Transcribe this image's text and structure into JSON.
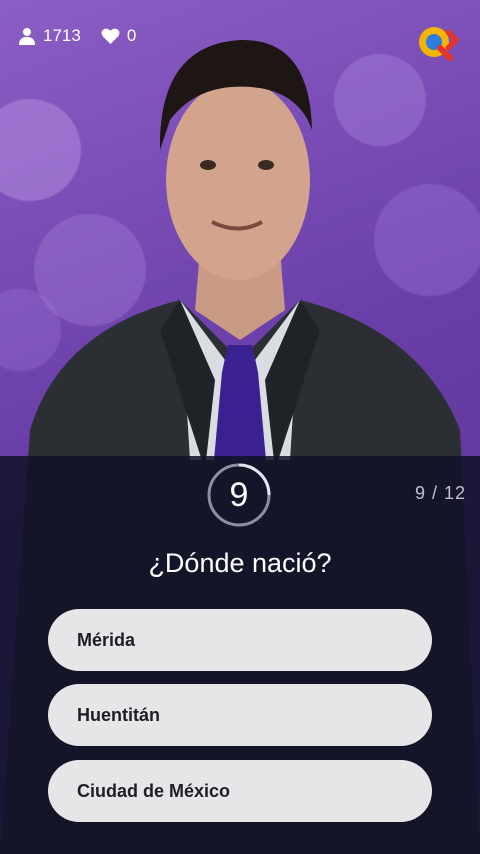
{
  "hud": {
    "players_count": "1713",
    "lives_count": "0",
    "players_icon": "person-icon",
    "lives_icon": "heart-icon"
  },
  "logo": {
    "icon": "app-logo-q",
    "colors": [
      "#f5b400",
      "#e8332a",
      "#2a7de1"
    ]
  },
  "quiz": {
    "timer_value": "9",
    "progress": "9 / 12",
    "question": "¿Dónde nació?",
    "answers": [
      "Mérida",
      "Huentitán",
      "Ciudad de México"
    ]
  },
  "colors": {
    "background_purple": "#6a3ea8",
    "panel": "#101228",
    "answer_bg": "#e6e6e8",
    "answer_text": "#1e1e24"
  }
}
